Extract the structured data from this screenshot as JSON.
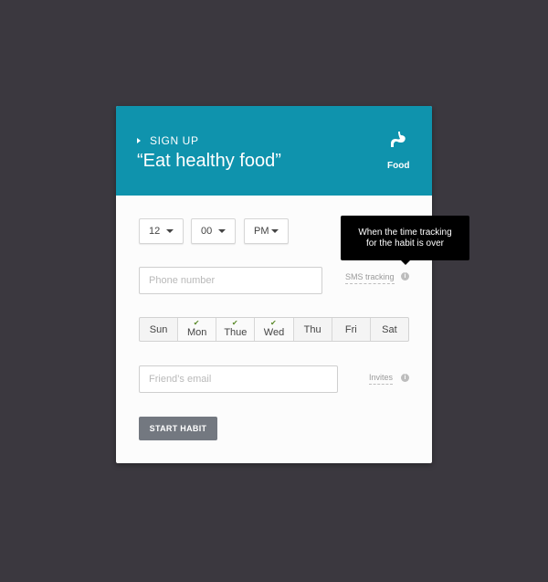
{
  "header": {
    "signup_label": "SIGN UP",
    "title": "“Eat healthy food”",
    "category_label": "Food",
    "background": "#0f93ad"
  },
  "time": {
    "hour": "12",
    "minute": "00",
    "period": "PM"
  },
  "phone": {
    "placeholder": "Phone number"
  },
  "sms": {
    "label": "SMS tracking"
  },
  "tooltip": {
    "text_line1": "When the time tracking",
    "text_line2": "for the habit is over"
  },
  "days": [
    {
      "label": "Sun",
      "checked": false
    },
    {
      "label": "Mon",
      "checked": true
    },
    {
      "label": "Thue",
      "checked": true
    },
    {
      "label": "Wed",
      "checked": true
    },
    {
      "label": "Thu",
      "checked": false
    },
    {
      "label": "Fri",
      "checked": false
    },
    {
      "label": "Sat",
      "checked": false
    }
  ],
  "invite": {
    "placeholder": "Friend’s email",
    "label": "Invites"
  },
  "start_button": {
    "label": "START HABIT"
  },
  "icons": {
    "category": "stomach-icon",
    "info": "info-icon",
    "check": "check-icon"
  }
}
